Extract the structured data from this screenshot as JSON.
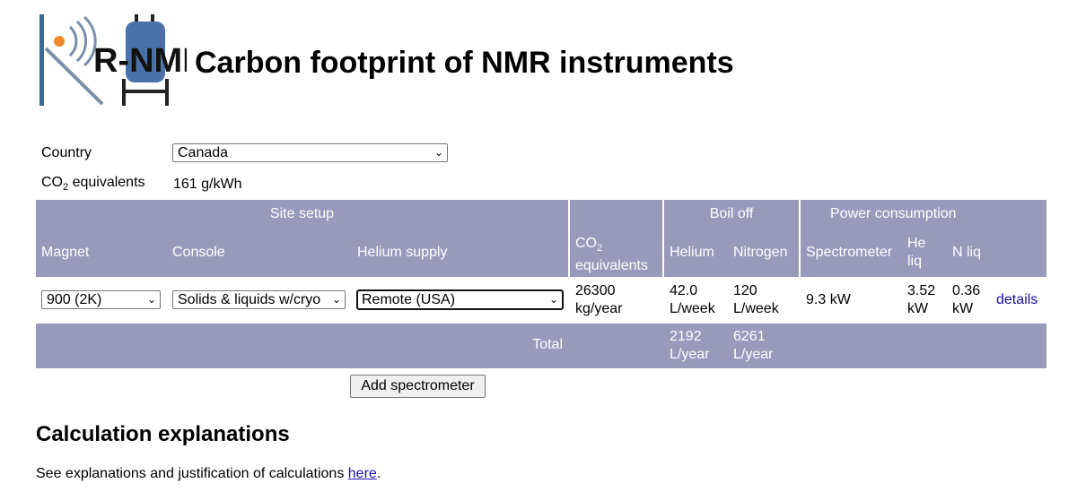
{
  "header": {
    "title": "Carbon footprint of NMR instruments",
    "logo_text": "R-NMR",
    "logo_colors": {
      "bar": "#3a6a9a",
      "dot": "#f08a2a",
      "tank": "#4a72a8",
      "text": "#111111"
    }
  },
  "form": {
    "country_label": "Country",
    "country_value": "Canada",
    "co2_label_main": "CO",
    "co2_label_sub": "2",
    "co2_label_rest": " equivalents",
    "co2_value": "161 g/kWh"
  },
  "table": {
    "header_color": "#9999bb",
    "groups": {
      "site_setup": "Site setup",
      "boil_off": "Boil off",
      "power_consumption": "Power consumption"
    },
    "columns": {
      "magnet": "Magnet",
      "console": "Console",
      "helium_supply": "Helium supply",
      "co2_main": "CO",
      "co2_sub": "2",
      "co2_rest": "equivalents",
      "helium": "Helium",
      "nitrogen": "Nitrogen",
      "spectrometer": "Spectrometer",
      "he_liq": "He liq",
      "n_liq": "N liq"
    },
    "row": {
      "magnet": "900 (2K)",
      "console": "Solids & liquids w/cryo",
      "helium_supply": "Remote (USA)",
      "co2": "26300 kg/year",
      "helium": "42.0 L/week",
      "nitrogen": "120 L/week",
      "spectrometer": "9.3 kW",
      "he_liq": "3.52 kW",
      "n_liq": "0.36 kW",
      "details": "details"
    },
    "total": {
      "label": "Total",
      "helium": "2192 L/year",
      "nitrogen": "6261 L/year"
    }
  },
  "add_button": "Add spectrometer",
  "section": {
    "heading": "Calculation explanations",
    "text": "See explanations and justification of calculations ",
    "link": "here",
    "after": "."
  }
}
